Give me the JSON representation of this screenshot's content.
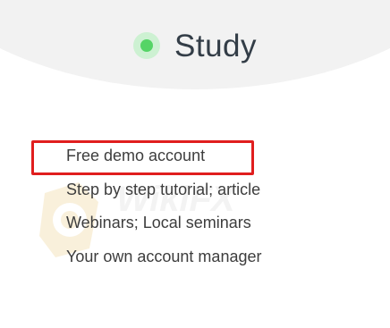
{
  "header": {
    "title": "Study",
    "status_color": "#55d466"
  },
  "features": {
    "items": [
      "Free demo account",
      "Step by step tutorial; article",
      "Webinars; Local seminars",
      "Your own account manager"
    ],
    "highlighted_index": 0,
    "highlight_color": "#e01e1e"
  },
  "watermark": {
    "text": "WikiFX"
  }
}
